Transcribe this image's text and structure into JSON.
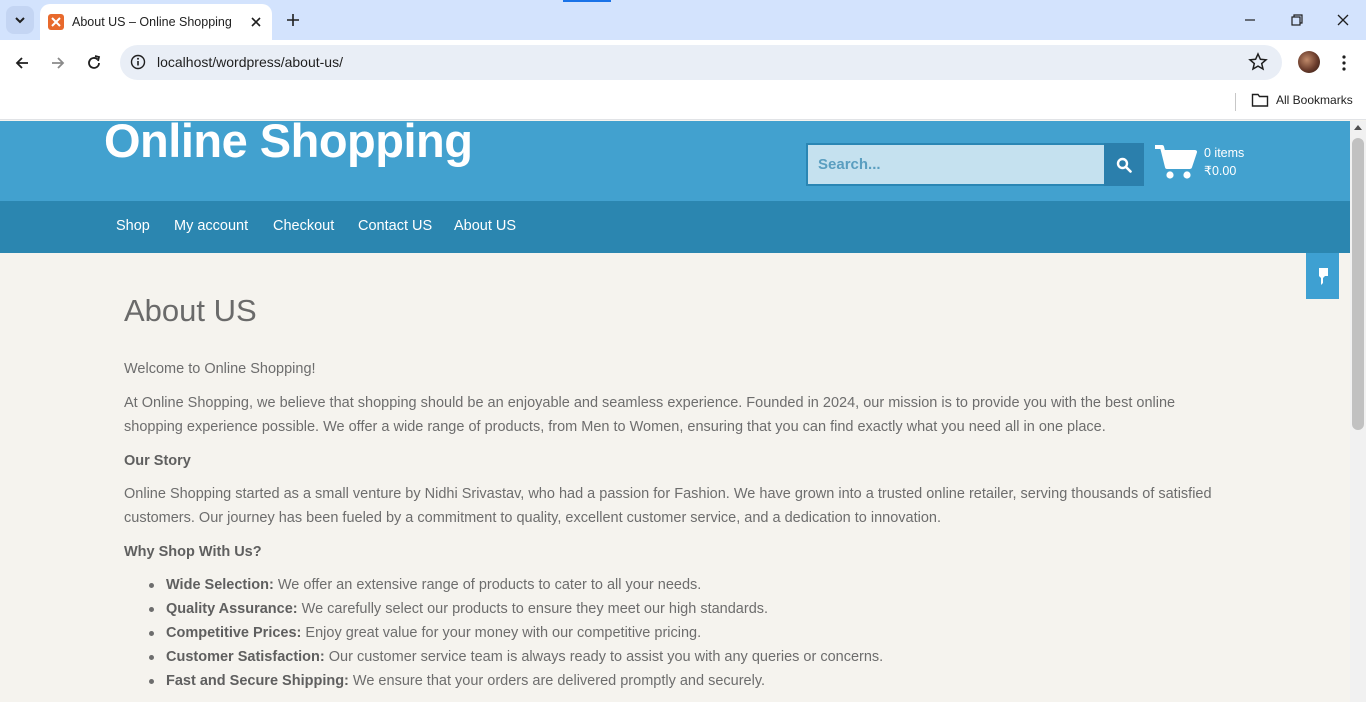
{
  "browser": {
    "tab_title": "About US – Online Shopping",
    "url": "localhost/wordpress/about-us/",
    "bookmarks_label": "All Bookmarks"
  },
  "site": {
    "title": "Online Shopping",
    "search_placeholder": "Search...",
    "cart": {
      "count_label": "0 items",
      "total_label": "₹0.00"
    }
  },
  "nav": {
    "items": [
      {
        "label": "Shop"
      },
      {
        "label": "My account"
      },
      {
        "label": "Checkout"
      },
      {
        "label": "Contact US"
      },
      {
        "label": "About US"
      }
    ]
  },
  "page": {
    "title": "About US",
    "welcome": "Welcome to Online Shopping!",
    "intro": "At Online Shopping, we believe that shopping should be an enjoyable and seamless experience. Founded in 2024, our mission is to provide you with the best online shopping experience possible. We offer a wide range of products, from Men to Women, ensuring that you can find exactly what you need all in one place.",
    "story_heading": "Our Story",
    "story": "Online Shopping started as a small venture by Nidhi Srivastav, who had a passion for Fashion. We have grown into a trusted online retailer, serving thousands of satisfied customers. Our journey has been fueled by a commitment to quality, excellent customer service, and a dedication to innovation.",
    "why_heading": "Why Shop With Us?",
    "reasons": [
      {
        "title": "Wide Selection:",
        "text": " We offer an extensive range of products to cater to all your needs."
      },
      {
        "title": "Quality Assurance:",
        "text": " We carefully select our products to ensure they meet our high standards."
      },
      {
        "title": "Competitive Prices:",
        "text": " Enjoy great value for your money with our competitive pricing."
      },
      {
        "title": "Customer Satisfaction:",
        "text": " Our customer service team is always ready to assist you with any queries or concerns."
      },
      {
        "title": "Fast and Secure Shipping:",
        "text": " We ensure that your orders are delivered promptly and securely."
      }
    ]
  },
  "colors": {
    "header_bg": "#42a1cf",
    "nav_bg": "#2b86b0",
    "page_bg": "#f5f3ee",
    "body_text": "#6d6d6d"
  },
  "icons": {
    "tab_menu": "chevron-down-icon",
    "favicon": "xampp-icon",
    "tab_close": "close-icon",
    "new_tab": "plus-icon",
    "back": "arrow-left-icon",
    "forward": "arrow-right-icon",
    "reload": "reload-icon",
    "site_info": "info-icon",
    "bookmark_star": "star-icon",
    "menu": "kebab-icon",
    "folder": "folder-icon",
    "search": "search-icon",
    "cart": "cart-icon",
    "sticky": "pin-icon"
  }
}
